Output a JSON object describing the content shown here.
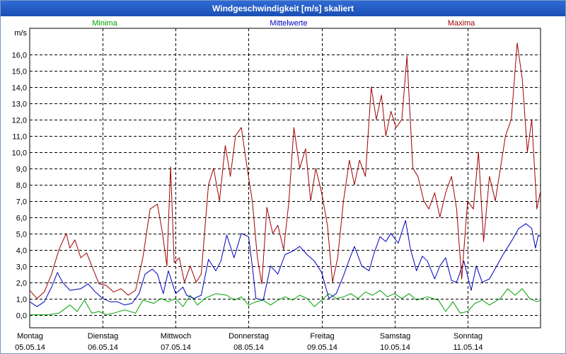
{
  "window": {
    "title": "Windgeschwindigkeit [m/s] skaliert"
  },
  "chart_data": {
    "type": "line",
    "title": "Windgeschwindigkeit [m/s] skaliert",
    "ylabel": "m/s",
    "xlabel": "",
    "ylim": [
      -0.8,
      17.6
    ],
    "yticks": [
      0,
      1,
      2,
      3,
      4,
      5,
      6,
      7,
      8,
      9,
      10,
      11,
      12,
      13,
      14,
      15,
      16
    ],
    "ytick_labels": [
      "0,0",
      "1,0",
      "2,0",
      "3,0",
      "4,0",
      "5,0",
      "6,0",
      "7,0",
      "8,0",
      "9,0",
      "10,0",
      "11,0",
      "12,0",
      "13,0",
      "14,0",
      "15,0",
      "16,0"
    ],
    "grid": true,
    "legend_position": "top",
    "x_range": [
      0,
      7
    ],
    "x_unit": "days since 05.05.14 00:00",
    "days": [
      {
        "weekday": "Montag",
        "date": "05.05.14"
      },
      {
        "weekday": "Dienstag",
        "date": "06.05.14"
      },
      {
        "weekday": "Mittwoch",
        "date": "07.05.14"
      },
      {
        "weekday": "Donnerstag",
        "date": "08.05.14"
      },
      {
        "weekday": "Freitag",
        "date": "09.05.14"
      },
      {
        "weekday": "Samstag",
        "date": "10.05.14"
      },
      {
        "weekday": "Sonntag",
        "date": "11.05.14"
      }
    ],
    "series": [
      {
        "name": "Minima",
        "color": "#00a000",
        "points": [
          [
            0.0,
            0.0
          ],
          [
            0.25,
            0.0
          ],
          [
            0.4,
            0.1
          ],
          [
            0.55,
            0.6
          ],
          [
            0.65,
            0.2
          ],
          [
            0.75,
            0.9
          ],
          [
            0.85,
            0.1
          ],
          [
            0.95,
            0.2
          ],
          [
            1.05,
            0.0
          ],
          [
            1.15,
            0.1
          ],
          [
            1.3,
            0.3
          ],
          [
            1.45,
            0.1
          ],
          [
            1.55,
            0.9
          ],
          [
            1.7,
            0.7
          ],
          [
            1.8,
            1.0
          ],
          [
            1.9,
            0.8
          ],
          [
            2.0,
            1.0
          ],
          [
            2.1,
            0.5
          ],
          [
            2.2,
            1.2
          ],
          [
            2.3,
            0.6
          ],
          [
            2.4,
            1.0
          ],
          [
            2.55,
            1.3
          ],
          [
            2.7,
            1.2
          ],
          [
            2.8,
            0.9
          ],
          [
            2.9,
            1.1
          ],
          [
            3.0,
            0.6
          ],
          [
            3.1,
            0.8
          ],
          [
            3.2,
            0.9
          ],
          [
            3.3,
            0.6
          ],
          [
            3.4,
            0.9
          ],
          [
            3.5,
            1.1
          ],
          [
            3.6,
            0.9
          ],
          [
            3.7,
            1.2
          ],
          [
            3.8,
            1.0
          ],
          [
            3.9,
            0.5
          ],
          [
            4.0,
            0.9
          ],
          [
            4.1,
            1.3
          ],
          [
            4.2,
            1.0
          ],
          [
            4.3,
            1.1
          ],
          [
            4.4,
            1.3
          ],
          [
            4.5,
            1.0
          ],
          [
            4.6,
            1.4
          ],
          [
            4.7,
            1.2
          ],
          [
            4.8,
            1.5
          ],
          [
            4.9,
            1.1
          ],
          [
            5.0,
            1.3
          ],
          [
            5.1,
            1.0
          ],
          [
            5.2,
            1.3
          ],
          [
            5.3,
            0.9
          ],
          [
            5.45,
            1.1
          ],
          [
            5.6,
            0.9
          ],
          [
            5.7,
            0.2
          ],
          [
            5.8,
            0.8
          ],
          [
            5.9,
            0.1
          ],
          [
            6.0,
            0.2
          ],
          [
            6.1,
            0.7
          ],
          [
            6.2,
            0.9
          ],
          [
            6.3,
            0.6
          ],
          [
            6.45,
            1.0
          ],
          [
            6.55,
            1.6
          ],
          [
            6.65,
            1.2
          ],
          [
            6.75,
            1.6
          ],
          [
            6.85,
            1.0
          ],
          [
            6.95,
            0.8
          ],
          [
            7.0,
            0.9
          ]
        ]
      },
      {
        "name": "Mittelwerte",
        "color": "#0000c0",
        "points": [
          [
            0.0,
            0.8
          ],
          [
            0.1,
            0.5
          ],
          [
            0.2,
            0.8
          ],
          [
            0.3,
            1.7
          ],
          [
            0.38,
            2.6
          ],
          [
            0.45,
            2.0
          ],
          [
            0.55,
            1.5
          ],
          [
            0.7,
            1.6
          ],
          [
            0.8,
            1.9
          ],
          [
            0.9,
            1.4
          ],
          [
            1.0,
            1.0
          ],
          [
            1.1,
            0.8
          ],
          [
            1.2,
            0.8
          ],
          [
            1.3,
            0.6
          ],
          [
            1.4,
            0.7
          ],
          [
            1.5,
            1.3
          ],
          [
            1.58,
            2.5
          ],
          [
            1.68,
            2.8
          ],
          [
            1.75,
            2.5
          ],
          [
            1.83,
            1.3
          ],
          [
            1.9,
            2.7
          ],
          [
            2.0,
            1.3
          ],
          [
            2.1,
            1.7
          ],
          [
            2.15,
            1.2
          ],
          [
            2.25,
            1.0
          ],
          [
            2.35,
            1.2
          ],
          [
            2.45,
            3.4
          ],
          [
            2.55,
            2.7
          ],
          [
            2.62,
            3.3
          ],
          [
            2.7,
            4.9
          ],
          [
            2.8,
            3.5
          ],
          [
            2.9,
            5.0
          ],
          [
            3.0,
            4.8
          ],
          [
            3.05,
            3.0
          ],
          [
            3.1,
            1.0
          ],
          [
            3.2,
            0.9
          ],
          [
            3.3,
            3.0
          ],
          [
            3.4,
            2.5
          ],
          [
            3.5,
            3.7
          ],
          [
            3.6,
            3.9
          ],
          [
            3.7,
            4.2
          ],
          [
            3.8,
            3.7
          ],
          [
            3.9,
            3.3
          ],
          [
            4.0,
            2.6
          ],
          [
            4.1,
            1.0
          ],
          [
            4.2,
            1.3
          ],
          [
            4.3,
            2.4
          ],
          [
            4.38,
            3.4
          ],
          [
            4.45,
            4.2
          ],
          [
            4.55,
            3.0
          ],
          [
            4.65,
            2.7
          ],
          [
            4.72,
            3.8
          ],
          [
            4.8,
            4.8
          ],
          [
            4.88,
            4.5
          ],
          [
            4.95,
            5.0
          ],
          [
            5.05,
            4.4
          ],
          [
            5.15,
            5.8
          ],
          [
            5.22,
            4.0
          ],
          [
            5.3,
            2.7
          ],
          [
            5.38,
            3.6
          ],
          [
            5.45,
            3.3
          ],
          [
            5.55,
            2.2
          ],
          [
            5.62,
            3.0
          ],
          [
            5.7,
            3.5
          ],
          [
            5.78,
            2.1
          ],
          [
            5.85,
            2.0
          ],
          [
            5.95,
            3.3
          ],
          [
            6.05,
            1.5
          ],
          [
            6.12,
            3.0
          ],
          [
            6.2,
            2.0
          ],
          [
            6.3,
            2.2
          ],
          [
            6.4,
            3.0
          ],
          [
            6.5,
            3.8
          ],
          [
            6.6,
            4.5
          ],
          [
            6.7,
            5.3
          ],
          [
            6.8,
            5.6
          ],
          [
            6.88,
            5.3
          ],
          [
            6.93,
            4.1
          ],
          [
            6.97,
            4.9
          ],
          [
            7.0,
            4.8
          ]
        ]
      },
      {
        "name": "Maxima",
        "color": "#a00000",
        "points": [
          [
            0.0,
            1.5
          ],
          [
            0.1,
            1.0
          ],
          [
            0.2,
            1.4
          ],
          [
            0.3,
            2.5
          ],
          [
            0.4,
            4.0
          ],
          [
            0.5,
            5.0
          ],
          [
            0.55,
            4.1
          ],
          [
            0.62,
            4.6
          ],
          [
            0.7,
            3.5
          ],
          [
            0.78,
            3.8
          ],
          [
            0.85,
            3.0
          ],
          [
            0.95,
            1.9
          ],
          [
            1.05,
            1.8
          ],
          [
            1.15,
            1.4
          ],
          [
            1.25,
            1.6
          ],
          [
            1.35,
            1.2
          ],
          [
            1.45,
            1.5
          ],
          [
            1.55,
            3.5
          ],
          [
            1.65,
            6.5
          ],
          [
            1.75,
            6.8
          ],
          [
            1.82,
            5.0
          ],
          [
            1.88,
            3.0
          ],
          [
            1.93,
            9.1
          ],
          [
            1.98,
            3.2
          ],
          [
            2.05,
            3.5
          ],
          [
            2.12,
            2.0
          ],
          [
            2.2,
            3.0
          ],
          [
            2.28,
            2.0
          ],
          [
            2.35,
            2.5
          ],
          [
            2.45,
            8.0
          ],
          [
            2.52,
            9.0
          ],
          [
            2.6,
            7.0
          ],
          [
            2.68,
            10.4
          ],
          [
            2.75,
            8.5
          ],
          [
            2.82,
            11.0
          ],
          [
            2.9,
            11.5
          ],
          [
            2.98,
            9.0
          ],
          [
            3.05,
            7.0
          ],
          [
            3.12,
            3.5
          ],
          [
            3.18,
            1.9
          ],
          [
            3.25,
            6.6
          ],
          [
            3.33,
            5.0
          ],
          [
            3.4,
            5.5
          ],
          [
            3.48,
            4.0
          ],
          [
            3.55,
            6.9
          ],
          [
            3.62,
            11.5
          ],
          [
            3.7,
            9.0
          ],
          [
            3.78,
            10.2
          ],
          [
            3.85,
            7.0
          ],
          [
            3.92,
            9.0
          ],
          [
            4.0,
            7.5
          ],
          [
            4.08,
            5.5
          ],
          [
            4.15,
            2.0
          ],
          [
            4.22,
            3.5
          ],
          [
            4.3,
            7.0
          ],
          [
            4.38,
            9.5
          ],
          [
            4.45,
            8.0
          ],
          [
            4.52,
            9.5
          ],
          [
            4.6,
            8.5
          ],
          [
            4.68,
            14.0
          ],
          [
            4.75,
            12.0
          ],
          [
            4.82,
            13.5
          ],
          [
            4.88,
            11.0
          ],
          [
            4.95,
            12.5
          ],
          [
            5.02,
            11.5
          ],
          [
            5.1,
            12.0
          ],
          [
            5.17,
            15.9
          ],
          [
            5.25,
            9.0
          ],
          [
            5.32,
            8.5
          ],
          [
            5.4,
            7.0
          ],
          [
            5.47,
            6.5
          ],
          [
            5.55,
            7.5
          ],
          [
            5.62,
            6.0
          ],
          [
            5.7,
            7.5
          ],
          [
            5.78,
            8.5
          ],
          [
            5.85,
            6.5
          ],
          [
            5.92,
            2.2
          ],
          [
            6.0,
            7.0
          ],
          [
            6.08,
            6.5
          ],
          [
            6.15,
            10.0
          ],
          [
            6.22,
            4.5
          ],
          [
            6.3,
            8.5
          ],
          [
            6.38,
            7.0
          ],
          [
            6.45,
            9.0
          ],
          [
            6.52,
            11.0
          ],
          [
            6.6,
            12.0
          ],
          [
            6.68,
            16.7
          ],
          [
            6.75,
            14.5
          ],
          [
            6.82,
            10.0
          ],
          [
            6.88,
            12.0
          ],
          [
            6.95,
            6.5
          ],
          [
            7.0,
            7.6
          ]
        ]
      }
    ]
  }
}
